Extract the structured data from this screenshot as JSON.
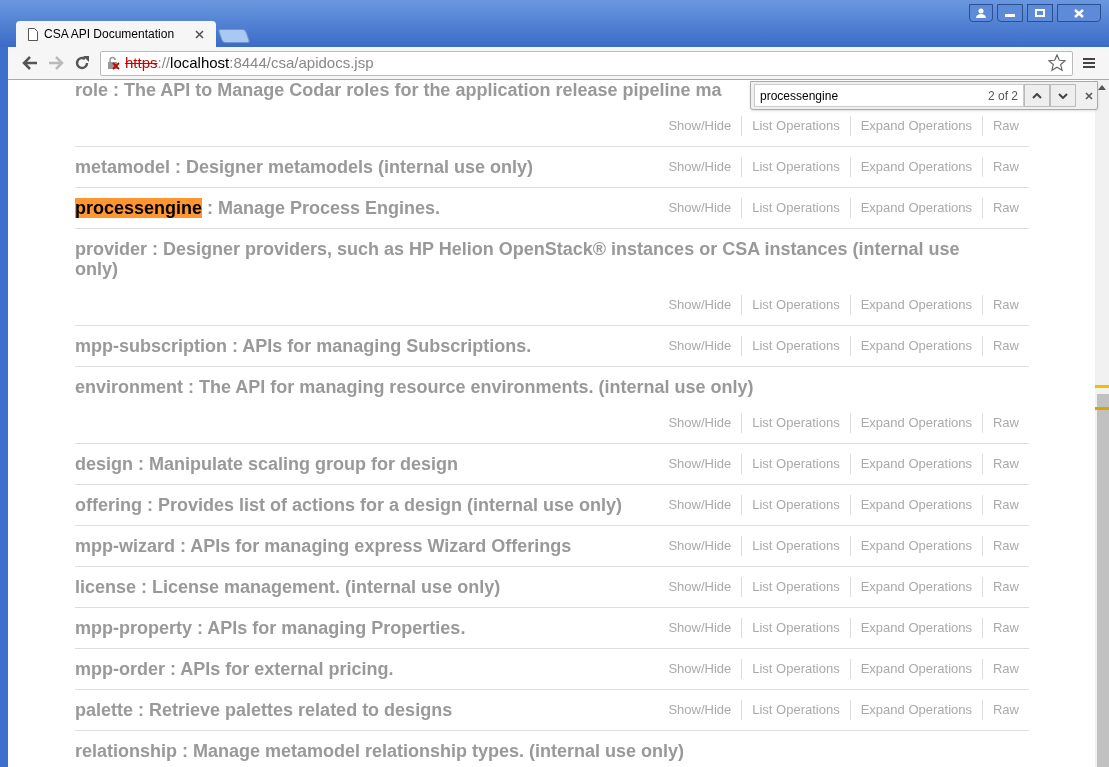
{
  "tabs": [
    {
      "title": "CSA API Documentation",
      "selected": true
    }
  ],
  "address": {
    "scheme": "https",
    "separator": "://",
    "host": "localhost",
    "rest": ":8444/csa/apidocs.jsp",
    "insecure": true
  },
  "find_bar": {
    "query": "processengine",
    "count": "2 of 2"
  },
  "resources": [
    {
      "name": "role",
      "description": " : The API to Manage Codar roles for the application release pipeline ma",
      "highlighted": false,
      "actions": [
        "Show/Hide",
        "List Operations",
        "Expand Operations",
        "Raw"
      ]
    },
    {
      "name": "metamodel",
      "description": " : Designer metamodels (internal use only)",
      "highlighted": false,
      "actions": [
        "Show/Hide",
        "List Operations",
        "Expand Operations",
        "Raw"
      ]
    },
    {
      "name": "processengine",
      "description": " : Manage Process Engines.",
      "highlighted": true,
      "actions": [
        "Show/Hide",
        "List Operations",
        "Expand Operations",
        "Raw"
      ]
    },
    {
      "name": "provider",
      "description": " : Designer providers, such as HP Helion OpenStack® instances or CSA instances (internal use only)",
      "highlighted": false,
      "actions": [
        "Show/Hide",
        "List Operations",
        "Expand Operations",
        "Raw"
      ]
    },
    {
      "name": "mpp-subscription",
      "description": " : APIs for managing Subscriptions.",
      "highlighted": false,
      "actions": [
        "Show/Hide",
        "List Operations",
        "Expand Operations",
        "Raw"
      ]
    },
    {
      "name": "environment",
      "description": " : The API for managing resource environments. (internal use only)",
      "highlighted": false,
      "actions": [
        "Show/Hide",
        "List Operations",
        "Expand Operations",
        "Raw"
      ]
    },
    {
      "name": "design",
      "description": " : Manipulate scaling group for design",
      "highlighted": false,
      "actions": [
        "Show/Hide",
        "List Operations",
        "Expand Operations",
        "Raw"
      ]
    },
    {
      "name": "offering",
      "description": " : Provides list of actions for a design (internal use only)",
      "highlighted": false,
      "actions": [
        "Show/Hide",
        "List Operations",
        "Expand Operations",
        "Raw"
      ]
    },
    {
      "name": "mpp-wizard",
      "description": " : APIs for managing express Wizard Offerings",
      "highlighted": false,
      "actions": [
        "Show/Hide",
        "List Operations",
        "Expand Operations",
        "Raw"
      ]
    },
    {
      "name": "license",
      "description": " : License management. (internal use only)",
      "highlighted": false,
      "actions": [
        "Show/Hide",
        "List Operations",
        "Expand Operations",
        "Raw"
      ]
    },
    {
      "name": "mpp-property",
      "description": " : APIs for managing Properties.",
      "highlighted": false,
      "actions": [
        "Show/Hide",
        "List Operations",
        "Expand Operations",
        "Raw"
      ]
    },
    {
      "name": "mpp-order",
      "description": " : APIs for external pricing.",
      "highlighted": false,
      "actions": [
        "Show/Hide",
        "List Operations",
        "Expand Operations",
        "Raw"
      ]
    },
    {
      "name": "palette",
      "description": " : Retrieve palettes related to designs",
      "highlighted": false,
      "actions": [
        "Show/Hide",
        "List Operations",
        "Expand Operations",
        "Raw"
      ]
    },
    {
      "name": "relationship",
      "description": " : Manage metamodel relationship types. (internal use only)",
      "highlighted": false
    }
  ]
}
